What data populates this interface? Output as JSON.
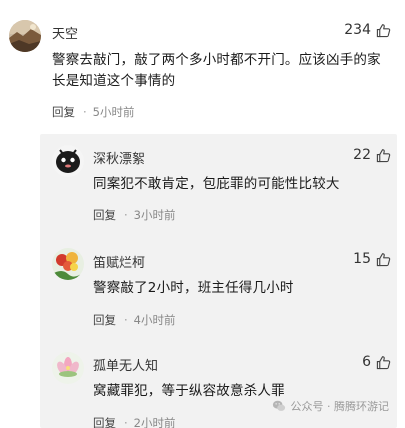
{
  "comments": [
    {
      "name": "天空",
      "likes": "234",
      "text": "警察去敲门，敲了两个多小时都不开门。应该凶手的家长是知道这个事情的",
      "reply": "回复",
      "time": "5小时前",
      "avatar": "landscape-avatar"
    }
  ],
  "replies": [
    {
      "name": "深秋漂絮",
      "likes": "22",
      "text": "同案犯不敢肯定，包庇罪的可能性比较大",
      "reply": "回复",
      "time": "3小时前",
      "avatar": "cartoon-avatar"
    },
    {
      "name": "笛赋烂柯",
      "likes": "15",
      "text": "警察敲了2小时，班主任得几小时",
      "reply": "回复",
      "time": "4小时前",
      "avatar": "flower-avatar"
    },
    {
      "name": "孤单无人知",
      "likes": "6",
      "text": "窝藏罪犯，等于纵容故意杀人罪",
      "reply": "回复",
      "time": "2小时前",
      "avatar": "lotus-avatar"
    }
  ],
  "watermark": "公众号 · 腾腾环游记",
  "icons": {
    "like": "thumbs-up-icon",
    "watermark": "wechat-icon"
  }
}
